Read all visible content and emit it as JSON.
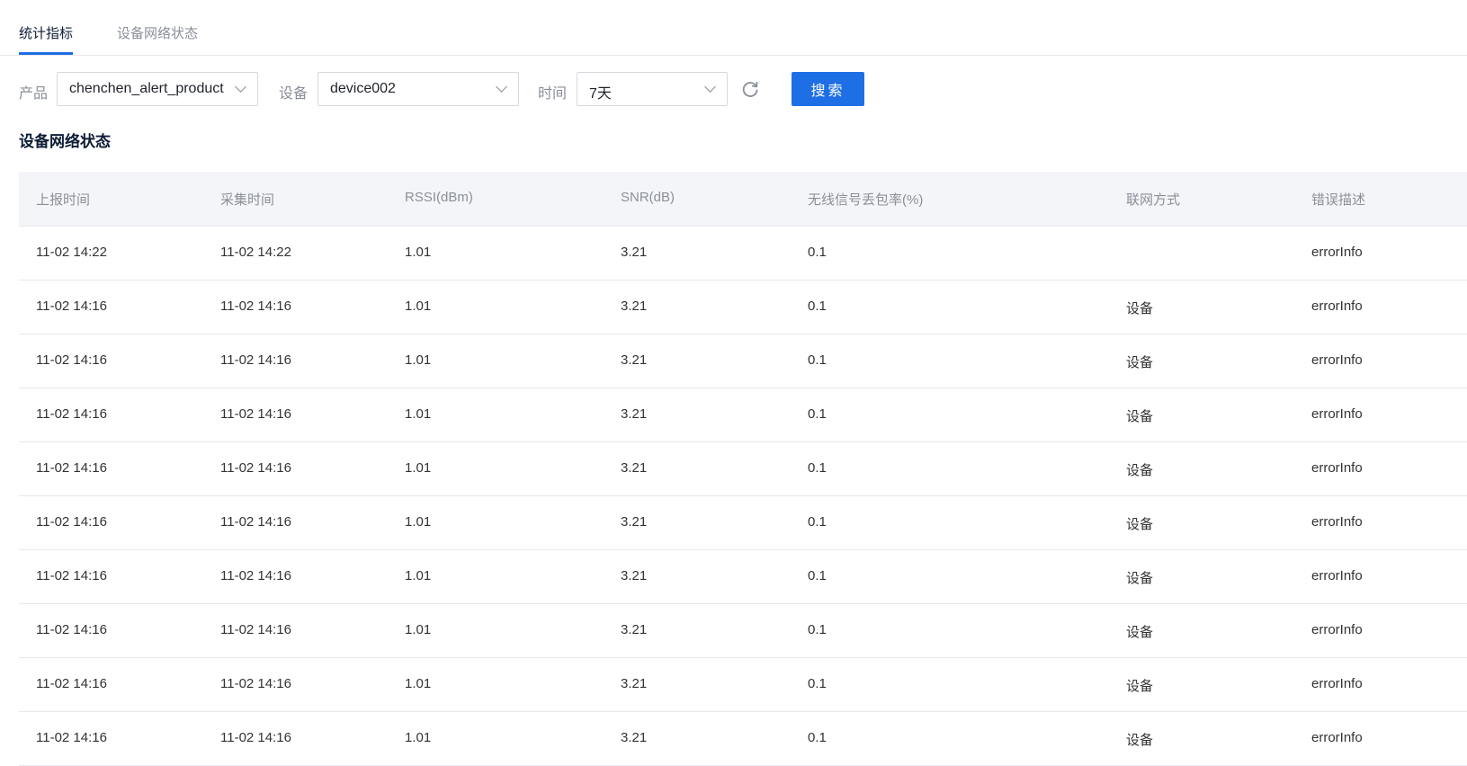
{
  "tabs": [
    {
      "label": "统计指标",
      "active": true
    },
    {
      "label": "设备网络状态",
      "active": false
    }
  ],
  "filters": {
    "product_label": "产品",
    "product_value": "chenchen_alert_product",
    "device_label": "设备",
    "device_value": "device002",
    "time_label": "时间",
    "time_value": "7天",
    "search_label": "搜索"
  },
  "section_title": "设备网络状态",
  "table": {
    "columns": [
      "上报时间",
      "采集时间",
      "RSSI(dBm)",
      "SNR(dB)",
      "无线信号丢包率(%)",
      "联网方式",
      "错误描述"
    ],
    "rows": [
      [
        "11-02 14:22",
        "11-02 14:22",
        "1.01",
        "3.21",
        "0.1",
        "",
        "errorInfo"
      ],
      [
        "11-02 14:16",
        "11-02 14:16",
        "1.01",
        "3.21",
        "0.1",
        "设备",
        "errorInfo"
      ],
      [
        "11-02 14:16",
        "11-02 14:16",
        "1.01",
        "3.21",
        "0.1",
        "设备",
        "errorInfo"
      ],
      [
        "11-02 14:16",
        "11-02 14:16",
        "1.01",
        "3.21",
        "0.1",
        "设备",
        "errorInfo"
      ],
      [
        "11-02 14:16",
        "11-02 14:16",
        "1.01",
        "3.21",
        "0.1",
        "设备",
        "errorInfo"
      ],
      [
        "11-02 14:16",
        "11-02 14:16",
        "1.01",
        "3.21",
        "0.1",
        "设备",
        "errorInfo"
      ],
      [
        "11-02 14:16",
        "11-02 14:16",
        "1.01",
        "3.21",
        "0.1",
        "设备",
        "errorInfo"
      ],
      [
        "11-02 14:16",
        "11-02 14:16",
        "1.01",
        "3.21",
        "0.1",
        "设备",
        "errorInfo"
      ],
      [
        "11-02 14:16",
        "11-02 14:16",
        "1.01",
        "3.21",
        "0.1",
        "设备",
        "errorInfo"
      ],
      [
        "11-02 14:16",
        "11-02 14:16",
        "1.01",
        "3.21",
        "0.1",
        "设备",
        "errorInfo"
      ]
    ]
  },
  "icons": {
    "select_arrow": "chevron-down-icon",
    "refresh": "refresh-icon"
  },
  "colors": {
    "accent": "#1e6fe6",
    "header_bg": "#f4f5f8",
    "border": "#e6e8eb"
  }
}
